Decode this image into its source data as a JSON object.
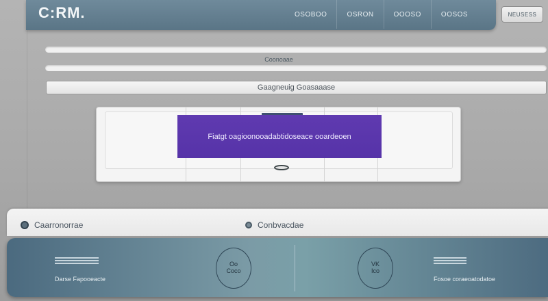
{
  "app": {
    "logo": "C:RM."
  },
  "header": {
    "nav": [
      "OSOBOO",
      "OSRON",
      "OOOSO",
      "OOSOS"
    ],
    "right_button": "NEUSESS"
  },
  "content": {
    "bar_caption": "Coonoaae",
    "search_label": "Gaagneuig Goasaaase"
  },
  "dialog": {
    "message": "Fiatgt oagioonooadabtidoseace ooardeoen"
  },
  "strip": {
    "left_label": "Caarronorrae",
    "right_label": "Conbvacdae"
  },
  "footer": {
    "left_label": "Darse Fapooeacte",
    "circle_left": "Oo\nCoco",
    "circle_right": "VK\nIco",
    "right_label": "Fosoe coraeoatodatoe"
  },
  "colors": {
    "header": "#5a7586",
    "accent_purple": "#5633a8",
    "footer": "#4b6a7f"
  }
}
